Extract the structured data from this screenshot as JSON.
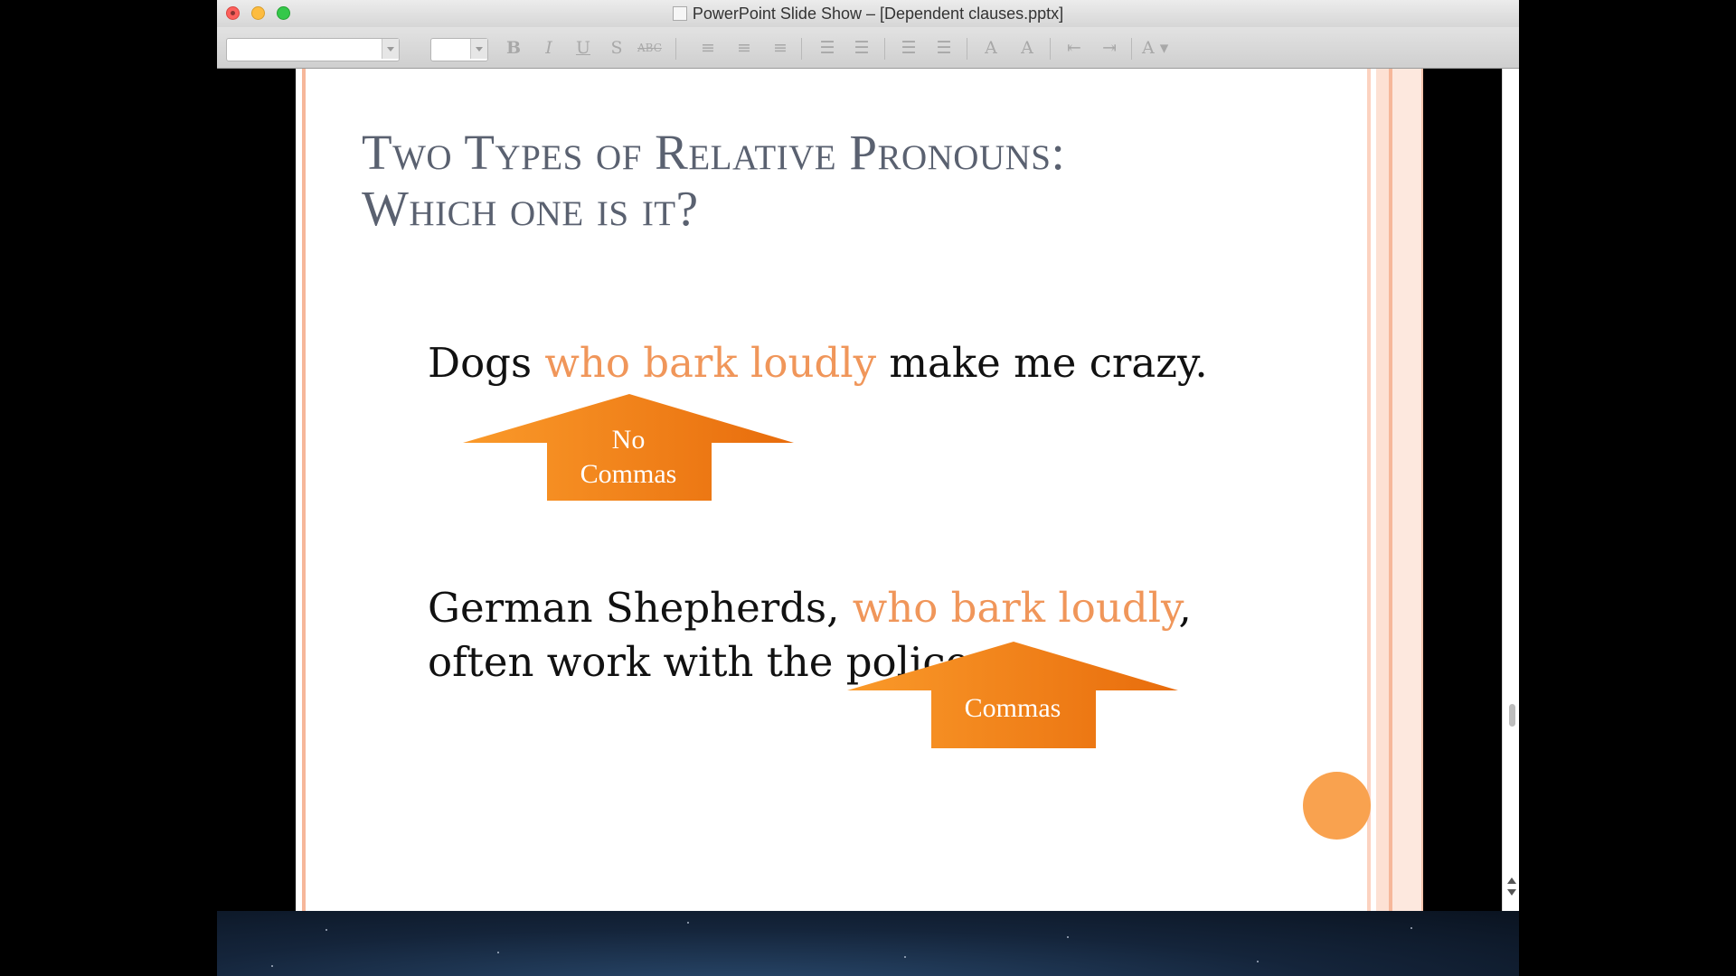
{
  "window": {
    "title": "PowerPoint Slide Show – [Dependent clauses.pptx]"
  },
  "toolbar": {
    "font_name": "",
    "font_size": "",
    "buttons": [
      {
        "name": "bold-button",
        "glyph": "B"
      },
      {
        "name": "italic-button",
        "glyph": "I"
      },
      {
        "name": "underline-button",
        "glyph": "U"
      },
      {
        "name": "shadow-button",
        "glyph": "S"
      },
      {
        "name": "strikethrough-button",
        "glyph": "ABC"
      },
      {
        "name": "align-left-button",
        "glyph": "≡"
      },
      {
        "name": "align-center-button",
        "glyph": "≡"
      },
      {
        "name": "align-right-button",
        "glyph": "≡"
      },
      {
        "name": "bullets-button",
        "glyph": "☰"
      },
      {
        "name": "numbering-button",
        "glyph": "☰"
      },
      {
        "name": "line-spacing-increase-button",
        "glyph": "☰"
      },
      {
        "name": "line-spacing-decrease-button",
        "glyph": "☰"
      },
      {
        "name": "font-size-increase-button",
        "glyph": "A"
      },
      {
        "name": "font-size-decrease-button",
        "glyph": "A"
      },
      {
        "name": "decrease-indent-button",
        "glyph": "⇤"
      },
      {
        "name": "increase-indent-button",
        "glyph": "⇥"
      },
      {
        "name": "font-color-button",
        "glyph": "A ▾"
      }
    ]
  },
  "slide": {
    "title_line1": "Two Types of Relative Pronouns:",
    "title_line2": "Which one is it?",
    "sentence1": {
      "before": "Dogs ",
      "highlight": "who bark loudly",
      "after": " make me crazy."
    },
    "arrow1_label_line1": "No",
    "arrow1_label_line2": "Commas",
    "sentence2": {
      "before": "German Shepherds, ",
      "highlight": "who bark loudly",
      "after": ",",
      "line2": "often work with the police"
    },
    "arrow2_label": "Commas"
  },
  "colors": {
    "accent_orange": "#f0965a",
    "arrow_orange": "#f28a1e",
    "title_gray": "#5a6170"
  }
}
